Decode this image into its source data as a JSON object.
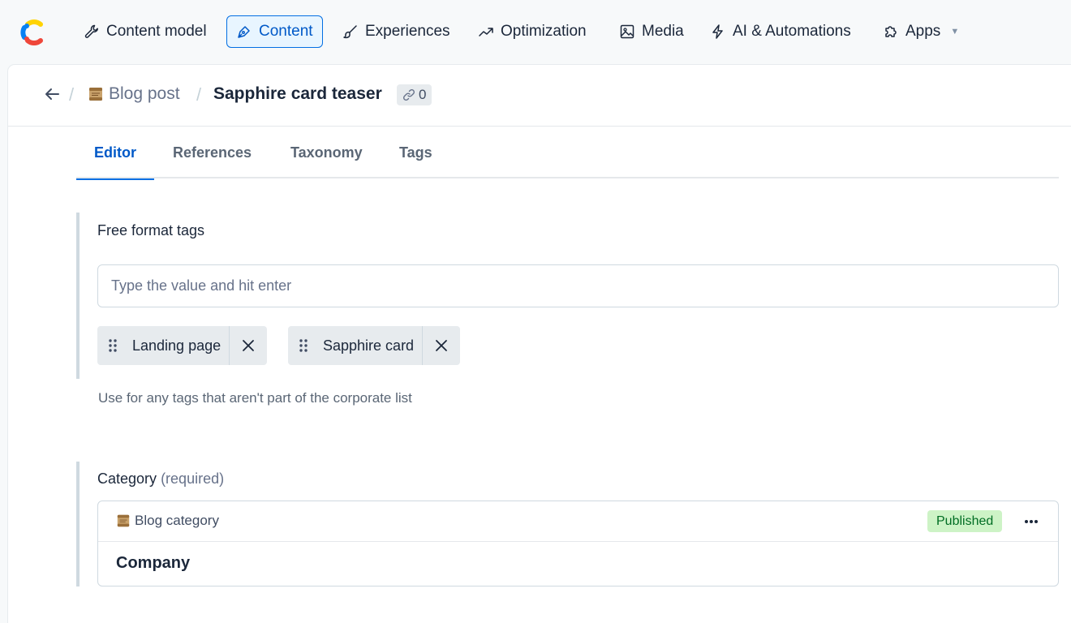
{
  "nav": {
    "items": [
      {
        "label": "Content model",
        "icon": "wrench-icon"
      },
      {
        "label": "Content",
        "icon": "pen-nib-icon",
        "active": true
      },
      {
        "label": "Experiences",
        "icon": "brush-icon"
      },
      {
        "label": "Optimization",
        "icon": "trend-up-icon"
      },
      {
        "label": "Media",
        "icon": "image-icon"
      },
      {
        "label": "AI & Automations",
        "icon": "lightning-icon"
      },
      {
        "label": "Apps",
        "icon": "puzzle-icon"
      }
    ]
  },
  "header": {
    "parent_label": "Blog post",
    "title": "Sapphire card teaser",
    "references_count": "0"
  },
  "tabs": [
    {
      "label": "Editor",
      "active": true
    },
    {
      "label": "References"
    },
    {
      "label": "Taxonomy"
    },
    {
      "label": "Tags"
    }
  ],
  "tags_field": {
    "label": "Free format tags",
    "input_value": "",
    "placeholder": "Type the value and hit enter",
    "tags": [
      "Landing page",
      "Sapphire card"
    ],
    "help_text": "Use for any tags that aren't part of the corporate list"
  },
  "category_field": {
    "label": "Category",
    "required_text": "(required)",
    "entry": {
      "content_type": "Blog category",
      "status": "Published",
      "title": "Company"
    }
  },
  "colors": {
    "accent": "#036fe3",
    "accent_text": "#0059c8",
    "status_published_bg": "#cdf3c6",
    "status_published_text": "#006d23"
  }
}
